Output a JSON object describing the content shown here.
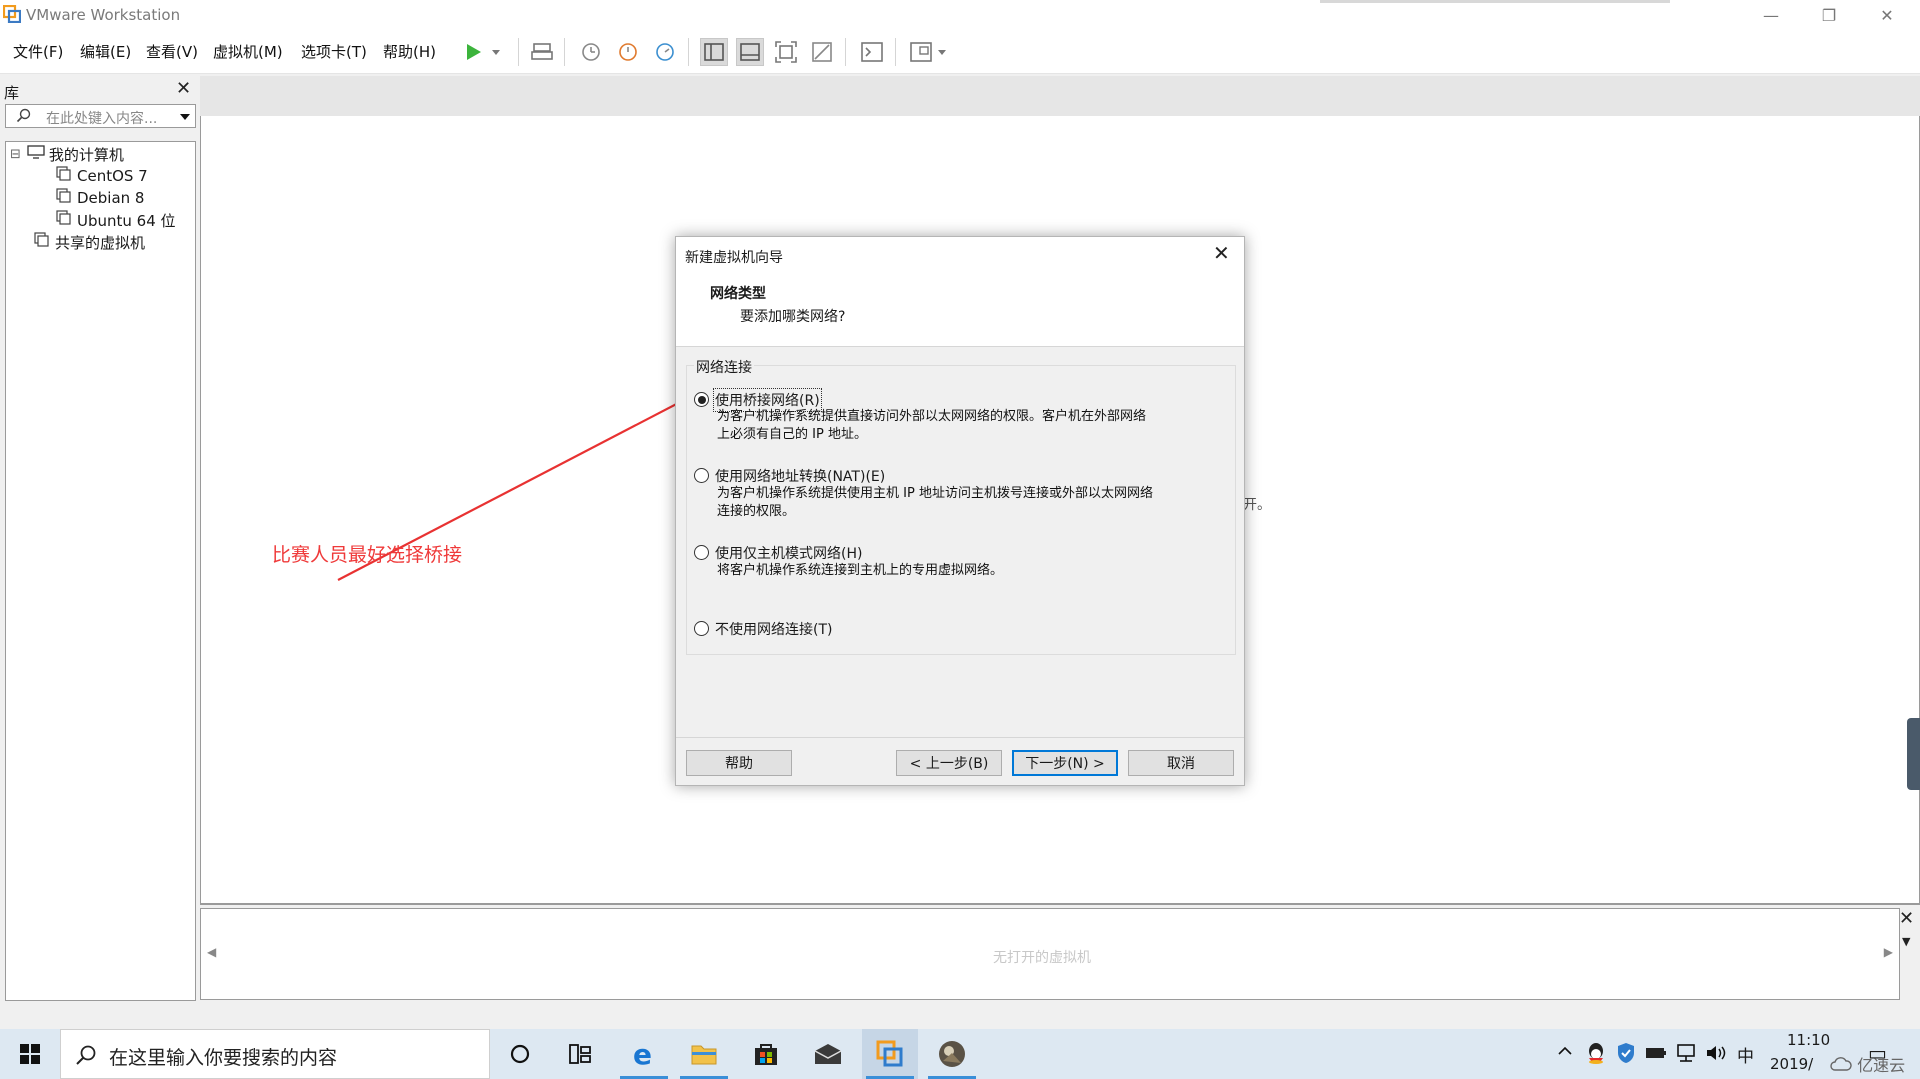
{
  "window": {
    "title": "VMware Workstation",
    "minimize": "—",
    "maximize": "❐",
    "close": "✕"
  },
  "menu": [
    "文件(F)",
    "编辑(E)",
    "查看(V)",
    "虚拟机(M)",
    "选项卡(T)",
    "帮助(H)"
  ],
  "toolbar_icons": [
    "power-on-icon",
    "dropdown-arrow-icon",
    "send-keys-icon",
    "snapshot-icon",
    "revert-snapshot-icon",
    "snapshot-manager-icon",
    "show-library-icon",
    "show-thumbnail-icon",
    "fullscreen-icon",
    "unity-icon",
    "console-icon",
    "view-options-icon"
  ],
  "library": {
    "title": "库",
    "close": "✕",
    "search_placeholder": "在此处键入内容...",
    "tree": {
      "root": "我的计算机",
      "children": [
        "CentOS 7",
        "Debian 8",
        "Ubuntu 64 位"
      ],
      "shared": "共享的虚拟机",
      "expander": "⊟"
    }
  },
  "thumbnail_bar": {
    "empty_text": "无打开的虚拟机",
    "left_arrow": "◀",
    "right_arrow": "▶",
    "close": "✕",
    "dropdown": "▼"
  },
  "dialog": {
    "title": "新建虚拟机向导",
    "close": "✕",
    "heading": "网络类型",
    "subheading": "要添加哪类网络?",
    "group_label": "网络连接",
    "options": [
      {
        "label": "使用桥接网络(R)",
        "desc_line1": "为客户机操作系统提供直接访问外部以太网网络的权限。客户机在外部网络",
        "desc_line2": "上必须有自己的 IP 地址。",
        "selected": true
      },
      {
        "label": "使用网络地址转换(NAT)(E)",
        "desc_line1": "为客户机操作系统提供使用主机 IP 地址访问主机拨号连接或外部以太网网络",
        "desc_line2": "连接的权限。",
        "selected": false
      },
      {
        "label": "使用仅主机模式网络(H)",
        "desc_line1": "将客户机操作系统连接到主机上的专用虚拟网络。",
        "desc_line2": "",
        "selected": false
      },
      {
        "label": "不使用网络连接(T)",
        "desc_line1": "",
        "desc_line2": "",
        "selected": false
      }
    ],
    "buttons": {
      "help": "帮助",
      "back": "< 上一步(B)",
      "next": "下一步(N) >",
      "cancel": "取消"
    }
  },
  "background_glimpse": "开。",
  "annotation": {
    "text": "比赛人员最好选择桥接",
    "color": "#ef3a3a"
  },
  "taskbar": {
    "search_placeholder": "在这里输入你要搜索的内容",
    "apps": [
      "cortana-icon",
      "task-view-icon",
      "edge-icon",
      "file-explorer-icon",
      "store-icon",
      "mail-icon",
      "vmware-icon",
      "photo-app-icon"
    ],
    "tray_icons": [
      "show-hidden-icons-icon",
      "qq-icon",
      "security-icon",
      "battery-icon",
      "network-icon",
      "volume-icon"
    ],
    "ime": "中",
    "time": "11:10",
    "date": "2019/",
    "notification": "▭"
  },
  "watermark": "亿速云"
}
